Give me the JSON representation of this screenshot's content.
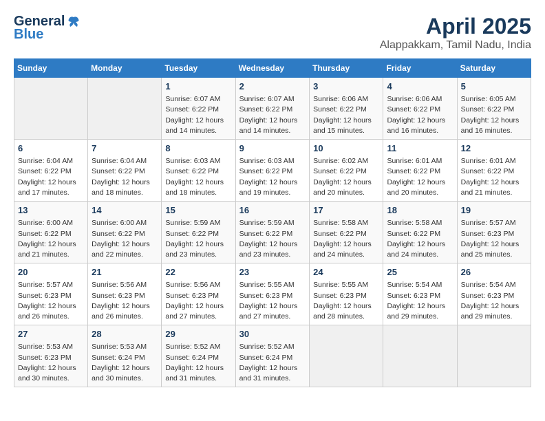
{
  "header": {
    "logo_general": "General",
    "logo_blue": "Blue",
    "title": "April 2025",
    "subtitle": "Alappakkam, Tamil Nadu, India"
  },
  "calendar": {
    "days_of_week": [
      "Sunday",
      "Monday",
      "Tuesday",
      "Wednesday",
      "Thursday",
      "Friday",
      "Saturday"
    ],
    "weeks": [
      [
        {
          "day": "",
          "detail": ""
        },
        {
          "day": "",
          "detail": ""
        },
        {
          "day": "1",
          "detail": "Sunrise: 6:07 AM\nSunset: 6:22 PM\nDaylight: 12 hours\nand 14 minutes."
        },
        {
          "day": "2",
          "detail": "Sunrise: 6:07 AM\nSunset: 6:22 PM\nDaylight: 12 hours\nand 14 minutes."
        },
        {
          "day": "3",
          "detail": "Sunrise: 6:06 AM\nSunset: 6:22 PM\nDaylight: 12 hours\nand 15 minutes."
        },
        {
          "day": "4",
          "detail": "Sunrise: 6:06 AM\nSunset: 6:22 PM\nDaylight: 12 hours\nand 16 minutes."
        },
        {
          "day": "5",
          "detail": "Sunrise: 6:05 AM\nSunset: 6:22 PM\nDaylight: 12 hours\nand 16 minutes."
        }
      ],
      [
        {
          "day": "6",
          "detail": "Sunrise: 6:04 AM\nSunset: 6:22 PM\nDaylight: 12 hours\nand 17 minutes."
        },
        {
          "day": "7",
          "detail": "Sunrise: 6:04 AM\nSunset: 6:22 PM\nDaylight: 12 hours\nand 18 minutes."
        },
        {
          "day": "8",
          "detail": "Sunrise: 6:03 AM\nSunset: 6:22 PM\nDaylight: 12 hours\nand 18 minutes."
        },
        {
          "day": "9",
          "detail": "Sunrise: 6:03 AM\nSunset: 6:22 PM\nDaylight: 12 hours\nand 19 minutes."
        },
        {
          "day": "10",
          "detail": "Sunrise: 6:02 AM\nSunset: 6:22 PM\nDaylight: 12 hours\nand 20 minutes."
        },
        {
          "day": "11",
          "detail": "Sunrise: 6:01 AM\nSunset: 6:22 PM\nDaylight: 12 hours\nand 20 minutes."
        },
        {
          "day": "12",
          "detail": "Sunrise: 6:01 AM\nSunset: 6:22 PM\nDaylight: 12 hours\nand 21 minutes."
        }
      ],
      [
        {
          "day": "13",
          "detail": "Sunrise: 6:00 AM\nSunset: 6:22 PM\nDaylight: 12 hours\nand 21 minutes."
        },
        {
          "day": "14",
          "detail": "Sunrise: 6:00 AM\nSunset: 6:22 PM\nDaylight: 12 hours\nand 22 minutes."
        },
        {
          "day": "15",
          "detail": "Sunrise: 5:59 AM\nSunset: 6:22 PM\nDaylight: 12 hours\nand 23 minutes."
        },
        {
          "day": "16",
          "detail": "Sunrise: 5:59 AM\nSunset: 6:22 PM\nDaylight: 12 hours\nand 23 minutes."
        },
        {
          "day": "17",
          "detail": "Sunrise: 5:58 AM\nSunset: 6:22 PM\nDaylight: 12 hours\nand 24 minutes."
        },
        {
          "day": "18",
          "detail": "Sunrise: 5:58 AM\nSunset: 6:22 PM\nDaylight: 12 hours\nand 24 minutes."
        },
        {
          "day": "19",
          "detail": "Sunrise: 5:57 AM\nSunset: 6:23 PM\nDaylight: 12 hours\nand 25 minutes."
        }
      ],
      [
        {
          "day": "20",
          "detail": "Sunrise: 5:57 AM\nSunset: 6:23 PM\nDaylight: 12 hours\nand 26 minutes."
        },
        {
          "day": "21",
          "detail": "Sunrise: 5:56 AM\nSunset: 6:23 PM\nDaylight: 12 hours\nand 26 minutes."
        },
        {
          "day": "22",
          "detail": "Sunrise: 5:56 AM\nSunset: 6:23 PM\nDaylight: 12 hours\nand 27 minutes."
        },
        {
          "day": "23",
          "detail": "Sunrise: 5:55 AM\nSunset: 6:23 PM\nDaylight: 12 hours\nand 27 minutes."
        },
        {
          "day": "24",
          "detail": "Sunrise: 5:55 AM\nSunset: 6:23 PM\nDaylight: 12 hours\nand 28 minutes."
        },
        {
          "day": "25",
          "detail": "Sunrise: 5:54 AM\nSunset: 6:23 PM\nDaylight: 12 hours\nand 29 minutes."
        },
        {
          "day": "26",
          "detail": "Sunrise: 5:54 AM\nSunset: 6:23 PM\nDaylight: 12 hours\nand 29 minutes."
        }
      ],
      [
        {
          "day": "27",
          "detail": "Sunrise: 5:53 AM\nSunset: 6:23 PM\nDaylight: 12 hours\nand 30 minutes."
        },
        {
          "day": "28",
          "detail": "Sunrise: 5:53 AM\nSunset: 6:24 PM\nDaylight: 12 hours\nand 30 minutes."
        },
        {
          "day": "29",
          "detail": "Sunrise: 5:52 AM\nSunset: 6:24 PM\nDaylight: 12 hours\nand 31 minutes."
        },
        {
          "day": "30",
          "detail": "Sunrise: 5:52 AM\nSunset: 6:24 PM\nDaylight: 12 hours\nand 31 minutes."
        },
        {
          "day": "",
          "detail": ""
        },
        {
          "day": "",
          "detail": ""
        },
        {
          "day": "",
          "detail": ""
        }
      ]
    ]
  }
}
